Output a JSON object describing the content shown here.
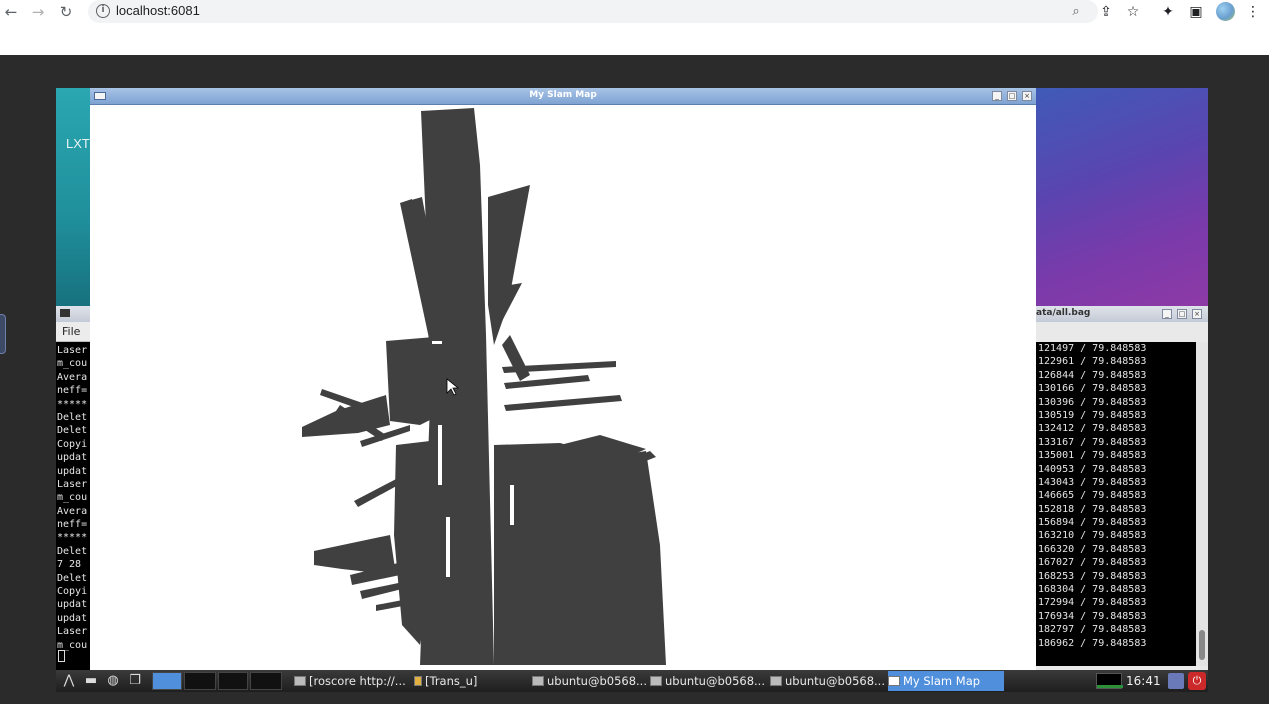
{
  "browser": {
    "url": "localhost:6081"
  },
  "desktop": {
    "wallpaper_label": "LXT"
  },
  "slam_window": {
    "title": "My Slam Map"
  },
  "left_terminal": {
    "menu_file": "File",
    "lines": [
      "Laser",
      "m_cou",
      "Avera",
      "neff=",
      "*****",
      "Delet",
      "Delet",
      "Copyi",
      "updat",
      "updat",
      "Laser",
      "m_cou",
      "Avera",
      "neff=",
      "*****",
      "Delet",
      "7 28",
      "Delet",
      "Copyi",
      "updat",
      "updat",
      "Laser",
      "m_cou"
    ]
  },
  "right_terminal": {
    "title": "ata/all.bag",
    "lines": [
      "121497 / 79.848583",
      "122961 / 79.848583",
      "126844 / 79.848583",
      "130166 / 79.848583",
      "130396 / 79.848583",
      "130519 / 79.848583",
      "132412 / 79.848583",
      "133167 / 79.848583",
      "135001 / 79.848583",
      "140953 / 79.848583",
      "143043 / 79.848583",
      "146665 / 79.848583",
      "152818 / 79.848583",
      "156894 / 79.848583",
      "163210 / 79.848583",
      "166320 / 79.848583",
      "167027 / 79.848583",
      "168253 / 79.848583",
      "168304 / 79.848583",
      "172994 / 79.848583",
      "176934 / 79.848583",
      "182797 / 79.848583",
      "186962 / 79.848583"
    ]
  },
  "taskbar": {
    "items": [
      "[roscore http://...",
      "[Trans_u]",
      "ubuntu@b0568...",
      "ubuntu@b0568...",
      "ubuntu@b0568...",
      "My Slam Map"
    ],
    "clock": "16:41"
  },
  "colors": {
    "map_fill": "#404040",
    "active_task": "#4f8fdc"
  }
}
